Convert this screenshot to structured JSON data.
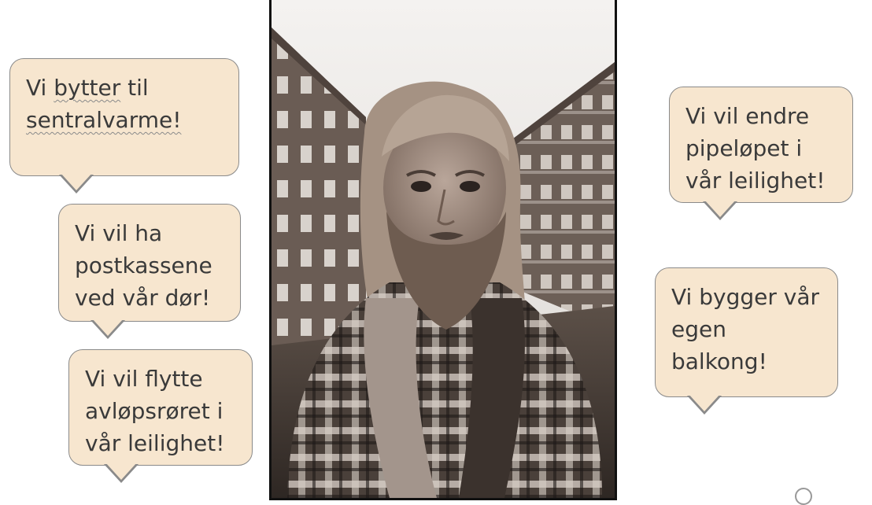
{
  "bubbles": [
    {
      "id": "b1",
      "lines": [
        "Vi bytter til",
        "sentralvarme!"
      ]
    },
    {
      "id": "b2",
      "lines": [
        "Vi vil ha",
        "postkassene",
        "ved vår dør!"
      ]
    },
    {
      "id": "b3",
      "lines": [
        "Vi vil flytte",
        "avløpsrøret i",
        "vår leilighet!"
      ]
    },
    {
      "id": "b4",
      "lines": [
        "Vi vil endre",
        "pipeløpet i",
        "vår leilighet!"
      ]
    },
    {
      "id": "b5",
      "lines": [
        "Vi bygger vår",
        "egen",
        "balkong!"
      ]
    }
  ],
  "colors": {
    "bubble_fill": "#f7e6cf",
    "bubble_border": "#8a8a8a",
    "text": "#3a3a3a",
    "photo_tone": "#6e5f55"
  }
}
